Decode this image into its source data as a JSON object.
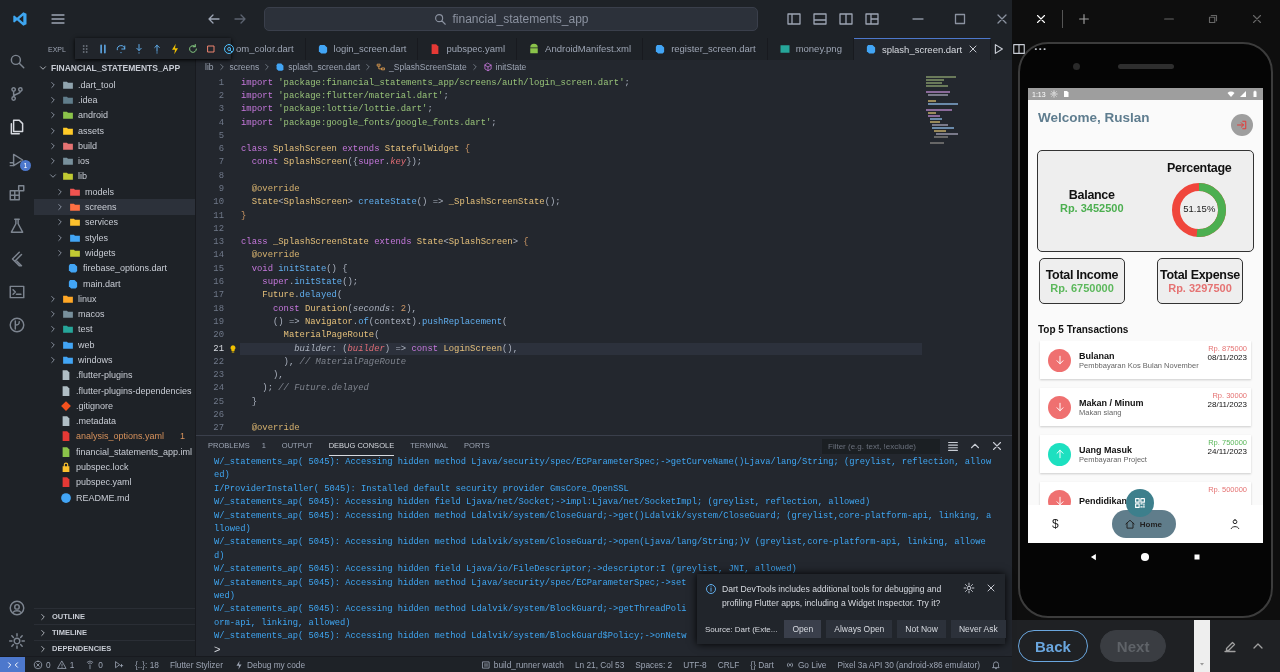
{
  "titlebar": {
    "search": "financial_statements_app"
  },
  "activity_bar": {
    "debug_badge": "1"
  },
  "explorer": {
    "header": "EXPL",
    "root": "FINANCIAL_STATEMENTS_APP",
    "tree": [
      {
        "name": ".dart_tool",
        "kind": "folder",
        "expanded": false,
        "selected": false,
        "color": "#90a4ae"
      },
      {
        "name": ".idea",
        "kind": "folder",
        "expanded": false,
        "selected": false,
        "color": "#607d8b"
      },
      {
        "name": "android",
        "kind": "folder",
        "expanded": false,
        "selected": false,
        "color": "#8bc34a"
      },
      {
        "name": "assets",
        "kind": "folder",
        "expanded": false,
        "selected": false,
        "color": "#ffca28"
      },
      {
        "name": "build",
        "kind": "folder",
        "expanded": false,
        "selected": false,
        "color": "#e57373"
      },
      {
        "name": "ios",
        "kind": "folder",
        "expanded": false,
        "selected": false,
        "color": "#78909c"
      },
      {
        "name": "lib",
        "kind": "folder",
        "expanded": true,
        "selected": false,
        "color": "#c0ca33",
        "children": [
          {
            "name": "models",
            "kind": "folder",
            "expanded": false,
            "selected": false,
            "color": "#ef5350"
          },
          {
            "name": "screens",
            "kind": "folder",
            "expanded": false,
            "selected": true,
            "color": "#ff7043"
          },
          {
            "name": "services",
            "kind": "folder",
            "expanded": false,
            "selected": false,
            "color": "#fbc02d"
          },
          {
            "name": "styles",
            "kind": "folder",
            "expanded": false,
            "selected": false,
            "color": "#42a5f5"
          },
          {
            "name": "widgets",
            "kind": "folder",
            "expanded": false,
            "selected": false,
            "color": "#c0ca33"
          },
          {
            "name": "firebase_options.dart",
            "kind": "dart",
            "selected": false,
            "color": "#42a5f5"
          },
          {
            "name": "main.dart",
            "kind": "dart",
            "selected": false,
            "color": "#42a5f5"
          }
        ]
      },
      {
        "name": "linux",
        "kind": "folder",
        "expanded": false,
        "selected": false,
        "color": "#ffa726"
      },
      {
        "name": "macos",
        "kind": "folder",
        "expanded": false,
        "selected": false,
        "color": "#78909c"
      },
      {
        "name": "test",
        "kind": "folder",
        "expanded": false,
        "selected": false,
        "color": "#26a69a"
      },
      {
        "name": "web",
        "kind": "folder",
        "expanded": false,
        "selected": false,
        "color": "#42a5f5"
      },
      {
        "name": "windows",
        "kind": "folder",
        "expanded": false,
        "selected": false,
        "color": "#42a5f5"
      },
      {
        "name": ".flutter-plugins",
        "kind": "file",
        "selected": false,
        "color": "#b0bec5"
      },
      {
        "name": ".flutter-plugins-dependencies",
        "kind": "file",
        "selected": false,
        "color": "#b0bec5"
      },
      {
        "name": ".gitignore",
        "kind": "git",
        "selected": false,
        "color": "#f4511e"
      },
      {
        "name": ".metadata",
        "kind": "file",
        "selected": false,
        "color": "#b0bec5"
      },
      {
        "name": "analysis_options.yaml",
        "kind": "file",
        "selected": false,
        "color": "#e53935",
        "warning": true,
        "badge": "1"
      },
      {
        "name": "financial_statements_app.iml",
        "kind": "file",
        "selected": false,
        "color": "#8bc34a"
      },
      {
        "name": "pubspec.lock",
        "kind": "lock",
        "selected": false,
        "color": "#fbc02d"
      },
      {
        "name": "pubspec.yaml",
        "kind": "file",
        "selected": false,
        "color": "#e53935"
      },
      {
        "name": "README.md",
        "kind": "info",
        "selected": false,
        "color": "#42a5f5"
      }
    ],
    "sections": [
      "OUTLINE",
      "TIMELINE",
      "DEPENDENCIES"
    ]
  },
  "editor_tabs": [
    {
      "label": "om_color.dart",
      "kind": "none",
      "selected": false
    },
    {
      "label": "login_screen.dart",
      "kind": "dart",
      "selected": false
    },
    {
      "label": "pubspec.yaml",
      "kind": "yaml",
      "selected": false
    },
    {
      "label": "AndroidManifest.xml",
      "kind": "android",
      "selected": false
    },
    {
      "label": "register_screen.dart",
      "kind": "dart",
      "selected": false
    },
    {
      "label": "money.png",
      "kind": "image",
      "selected": false
    },
    {
      "label": "splash_screen.dart",
      "kind": "dart",
      "selected": true
    }
  ],
  "breadcrumb": [
    "lib",
    "screens",
    "splash_screen.dart",
    "_SplashScreenState",
    "initState"
  ],
  "code": [
    {
      "number": "1",
      "current": false,
      "tokens": [
        {
          "kind": "kw",
          "text": "import "
        },
        {
          "kind": "str",
          "text": "'package:financial_statements_app/screens/auth/login_screen.dart'"
        },
        {
          "kind": "p",
          "text": ";"
        }
      ]
    },
    {
      "number": "2",
      "current": false,
      "tokens": [
        {
          "kind": "kw",
          "text": "import "
        },
        {
          "kind": "str",
          "text": "'package:flutter/material.dart'"
        },
        {
          "kind": "p",
          "text": ";"
        }
      ]
    },
    {
      "number": "3",
      "current": false,
      "tokens": [
        {
          "kind": "kw",
          "text": "import "
        },
        {
          "kind": "str",
          "text": "'package:lottie/lottie.dart'"
        },
        {
          "kind": "p",
          "text": ";"
        }
      ]
    },
    {
      "number": "4",
      "current": false,
      "tokens": [
        {
          "kind": "kw",
          "text": "import "
        },
        {
          "kind": "str",
          "text": "'package:google_fonts/google_fonts.dart'"
        },
        {
          "kind": "p",
          "text": ";"
        }
      ]
    },
    {
      "number": "5",
      "current": false
    },
    {
      "number": "6",
      "current": false,
      "tokens": [
        {
          "kind": "kw",
          "text": "class "
        },
        {
          "kind": "type",
          "text": "SplashScreen "
        },
        {
          "kind": "kw",
          "text": "extends "
        },
        {
          "kind": "type",
          "text": "StatefulWidget "
        },
        {
          "kind": "br",
          "text": "{"
        }
      ]
    },
    {
      "number": "7",
      "current": false,
      "tokens": [
        {
          "kind": "kw",
          "text": "  const "
        },
        {
          "kind": "type",
          "text": "SplashScreen"
        },
        {
          "kind": "p",
          "text": "({"
        },
        {
          "kind": "kw",
          "text": "super"
        },
        {
          "kind": "p",
          "text": "."
        },
        {
          "kind": "param",
          "text": "key"
        },
        {
          "kind": "p",
          "text": "});"
        }
      ]
    },
    {
      "number": "8",
      "current": false
    },
    {
      "number": "9",
      "current": false,
      "tokens": [
        {
          "kind": "meta",
          "text": "  @override"
        }
      ]
    },
    {
      "number": "10",
      "current": false,
      "tokens": [
        {
          "kind": "type",
          "text": "  State"
        },
        {
          "kind": "p",
          "text": "<"
        },
        {
          "kind": "type",
          "text": "SplashScreen"
        },
        {
          "kind": "p",
          "text": "> "
        },
        {
          "kind": "fn",
          "text": "createState"
        },
        {
          "kind": "p",
          "text": "() => "
        },
        {
          "kind": "type",
          "text": "_SplashScreenState"
        },
        {
          "kind": "p",
          "text": "();"
        }
      ]
    },
    {
      "number": "11",
      "current": false,
      "tokens": [
        {
          "kind": "br",
          "text": "}"
        }
      ]
    },
    {
      "number": "12",
      "current": false
    },
    {
      "number": "13",
      "current": false,
      "tokens": [
        {
          "kind": "kw",
          "text": "class "
        },
        {
          "kind": "type",
          "text": "_SplashScreenState "
        },
        {
          "kind": "kw",
          "text": "extends "
        },
        {
          "kind": "type",
          "text": "State"
        },
        {
          "kind": "p",
          "text": "<"
        },
        {
          "kind": "type",
          "text": "SplashScreen"
        },
        {
          "kind": "p",
          "text": ">"
        },
        {
          "kind": "br",
          "text": " {"
        }
      ]
    },
    {
      "number": "14",
      "current": false,
      "tokens": [
        {
          "kind": "meta",
          "text": "  @override"
        }
      ]
    },
    {
      "number": "15",
      "current": false,
      "tokens": [
        {
          "kind": "kw",
          "text": "  void "
        },
        {
          "kind": "fn",
          "text": "initState"
        },
        {
          "kind": "p",
          "text": "() {"
        }
      ]
    },
    {
      "number": "16",
      "current": false,
      "tokens": [
        {
          "kind": "kw",
          "text": "    super"
        },
        {
          "kind": "p",
          "text": "."
        },
        {
          "kind": "fn",
          "text": "initState"
        },
        {
          "kind": "p",
          "text": "();"
        }
      ]
    },
    {
      "number": "17",
      "current": false,
      "tokens": [
        {
          "kind": "type",
          "text": "    Future"
        },
        {
          "kind": "p",
          "text": "."
        },
        {
          "kind": "fn",
          "text": "delayed"
        },
        {
          "kind": "p",
          "text": "("
        }
      ]
    },
    {
      "number": "18",
      "current": false,
      "tokens": [
        {
          "kind": "kw",
          "text": "      const "
        },
        {
          "kind": "type",
          "text": "Duration"
        },
        {
          "kind": "p",
          "text": "("
        },
        {
          "kind": "label",
          "text": "seconds"
        },
        {
          "kind": "p",
          "text": ": "
        },
        {
          "kind": "num",
          "text": "2"
        },
        {
          "kind": "p",
          "text": "),"
        }
      ]
    },
    {
      "number": "19",
      "current": false,
      "tokens": [
        {
          "kind": "p",
          "text": "      () => "
        },
        {
          "kind": "type",
          "text": "Navigator"
        },
        {
          "kind": "p",
          "text": "."
        },
        {
          "kind": "fn",
          "text": "of"
        },
        {
          "kind": "p",
          "text": "(context)."
        },
        {
          "kind": "fn",
          "text": "pushReplacement"
        },
        {
          "kind": "p",
          "text": "("
        }
      ]
    },
    {
      "number": "20",
      "current": false,
      "tokens": [
        {
          "kind": "type",
          "text": "        MaterialPageRoute"
        },
        {
          "kind": "p",
          "text": "("
        }
      ]
    },
    {
      "number": "21",
      "current": true,
      "tokens": [
        {
          "kind": "label",
          "text": "          builder"
        },
        {
          "kind": "p",
          "text": ": ("
        },
        {
          "kind": "param",
          "text": "builder"
        },
        {
          "kind": "p",
          "text": ") => "
        },
        {
          "kind": "kw",
          "text": "const "
        },
        {
          "kind": "type",
          "text": "LoginScreen"
        },
        {
          "kind": "p",
          "text": "(),"
        }
      ]
    },
    {
      "number": "22",
      "current": false,
      "tokens": [
        {
          "kind": "p",
          "text": "        ), "
        },
        {
          "kind": "cm",
          "text": "// MaterialPageRoute"
        }
      ]
    },
    {
      "number": "23",
      "current": false,
      "tokens": [
        {
          "kind": "p",
          "text": "      ),"
        }
      ]
    },
    {
      "number": "24",
      "current": false,
      "tokens": [
        {
          "kind": "p",
          "text": "    ); "
        },
        {
          "kind": "cm",
          "text": "// Future.delayed"
        }
      ]
    },
    {
      "number": "25",
      "current": false,
      "tokens": [
        {
          "kind": "p",
          "text": "  }"
        }
      ]
    },
    {
      "number": "26",
      "current": false
    },
    {
      "number": "27",
      "current": false,
      "tokens": [
        {
          "kind": "meta",
          "text": "  @override"
        }
      ]
    }
  ],
  "panel": {
    "tabs": [
      {
        "label": "PROBLEMS",
        "count": "1",
        "selected": false
      },
      {
        "label": "OUTPUT",
        "selected": false
      },
      {
        "label": "DEBUG CONSOLE",
        "selected": true
      },
      {
        "label": "TERMINAL",
        "selected": false
      },
      {
        "label": "PORTS",
        "selected": false
      }
    ],
    "filter": {
      "placeholder": "Filter (e.g. text, !exclude)"
    },
    "console": [
      "W/_statements_ap( 5045): Accessing hidden method Ljava/security/spec/ECParameterSpec;->getCurveName()Ljava/lang/String; (greylist, reflection, allow",
      "ed)",
      "I/ProviderInstaller( 5045): Installed default security provider GmsCore_OpenSSL",
      "W/_statements_ap( 5045): Accessing hidden field Ljava/net/Socket;->impl:Ljava/net/SocketImpl; (greylist, reflection, allowed)",
      "W/_statements_ap( 5045): Accessing hidden method Ldalvik/system/CloseGuard;->get()Ldalvik/system/CloseGuard; (greylist,core-platform-api, linking, a",
      "llowed)",
      "W/_statements_ap( 5045): Accessing hidden method Ldalvik/system/CloseGuard;->open(Ljava/lang/String;)V (greylist,core-platform-api, linking, allowe",
      "d)",
      "W/_statements_ap( 5045): Accessing hidden field Ljava/io/FileDescriptor;->descriptor:I (greylist, JNI, allowed)",
      "W/_statements_ap( 5045): Accessing hidden method Ljava/security/spec/ECParameterSpec;->set",
      "wed)",
      "W/_statements_ap( 5045): Accessing hidden method Ldalvik/system/BlockGuard;->getThreadPoli",
      "orm-api, linking, allowed)",
      "W/_statements_ap( 5045): Accessing hidden method Ldalvik/system/BlockGuard$Policy;->onNetw"
    ],
    "prompt": ">"
  },
  "notification": {
    "message": "Dart DevTools includes additional tools for debugging and profiling Flutter apps, including a Widget Inspector. Try it?",
    "source": "Source: Dart (Exte...",
    "buttons": [
      {
        "label": "Open",
        "primary": true
      },
      {
        "label": "Always Open",
        "primary": false
      },
      {
        "label": "Not Now",
        "primary": false
      },
      {
        "label": "Never Ask",
        "primary": false
      }
    ]
  },
  "status_bar": {
    "errors": "0",
    "warnings": "1",
    "ports": "0",
    "left": [
      {
        "text": "{..}: 18",
        "kind": "plain"
      },
      {
        "text": "Flutter Stylizer",
        "kind": "plain"
      },
      {
        "text": "Debug my code",
        "kind": "bolt"
      }
    ],
    "right": [
      {
        "text": "build_runner watch",
        "kind": "tool"
      },
      {
        "text": "Ln 21, Col 53",
        "kind": "plain"
      },
      {
        "text": "Spaces: 2",
        "kind": "plain"
      },
      {
        "text": "UTF-8",
        "kind": "plain"
      },
      {
        "text": "CRLF",
        "kind": "plain"
      },
      {
        "text": "{} Dart",
        "kind": "plain"
      },
      {
        "text": "Go Live",
        "kind": "live"
      },
      {
        "text": "Pixel 3a API 30 (android-x86 emulator)",
        "kind": "plain"
      }
    ]
  },
  "phone": {
    "status_time": "1:13",
    "welcome": "Welcome, Ruslan",
    "balance_label": "Balance",
    "balance": "Rp. 3452500",
    "percentage_label": "Percentage",
    "percentage": "51.15%",
    "level": 0.5115,
    "totals": [
      {
        "label": "Total Income",
        "value": "Rp. 6750000",
        "kind": "income"
      },
      {
        "label": "Total Expense",
        "value": "Rp. 3297500",
        "kind": "expense"
      }
    ],
    "list_title": "Top 5 Transactions",
    "transactions": [
      {
        "kind": "expense",
        "title": "Bulanan",
        "note": "Pembbayaran Kos Bulan November",
        "amount": "Rp. 875000",
        "date": "08/11/2023"
      },
      {
        "kind": "expense",
        "title": "Makan / Minum",
        "note": "Makan siang",
        "amount": "Rp. 30000",
        "date": "28/11/2023"
      },
      {
        "kind": "income",
        "title": "Uang Masuk",
        "note": "Pembayaran Project",
        "amount": "Rp. 750000",
        "date": "24/11/2023"
      },
      {
        "kind": "expense",
        "title": "Pendidikan",
        "amount": "Rp. 500000"
      }
    ],
    "nav": [
      {
        "kind": "money",
        "icon": "$",
        "selected": false
      },
      {
        "kind": "home",
        "label": "Home",
        "selected": true
      },
      {
        "kind": "profile",
        "selected": false
      }
    ]
  },
  "emulator_buttons": [
    {
      "label": "Back",
      "disabled": false
    },
    {
      "label": "Next",
      "disabled": true
    }
  ]
}
